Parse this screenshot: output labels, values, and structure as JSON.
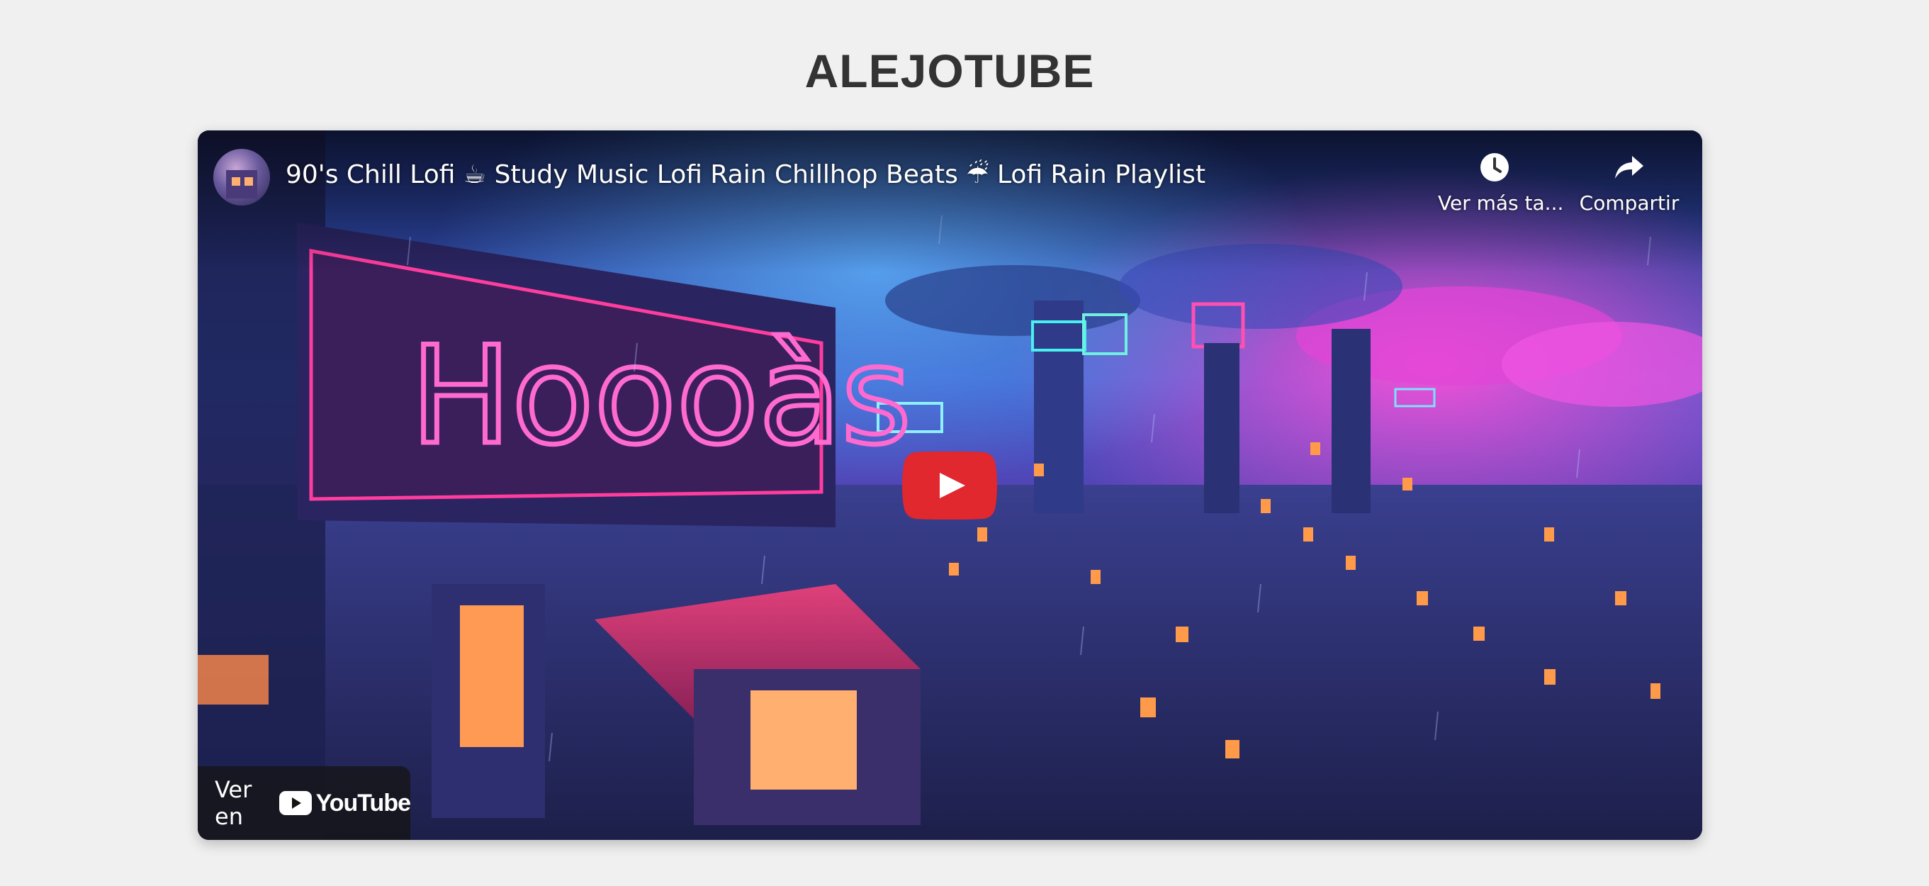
{
  "page": {
    "site_title": "ALEJOTUBE"
  },
  "video": {
    "title": "90's Chill Lofi ☕ Study Music Lofi Rain Chillhop Beats ☔ Lofi Rain Playlist",
    "channel_avatar_icon": "channel-avatar",
    "thumbnail_sign_text": "Hoooàs",
    "actions": {
      "watch_later_label": "Ver más ta...",
      "watch_later_icon": "clock-icon",
      "share_label": "Compartir",
      "share_icon": "share-arrow-icon"
    },
    "play_button_icon": "play-icon",
    "play_button_color": "#e0282e",
    "watch_on": {
      "prefix": "Ver en",
      "brand": "YouTube",
      "brand_icon": "youtube-logo-icon"
    }
  }
}
